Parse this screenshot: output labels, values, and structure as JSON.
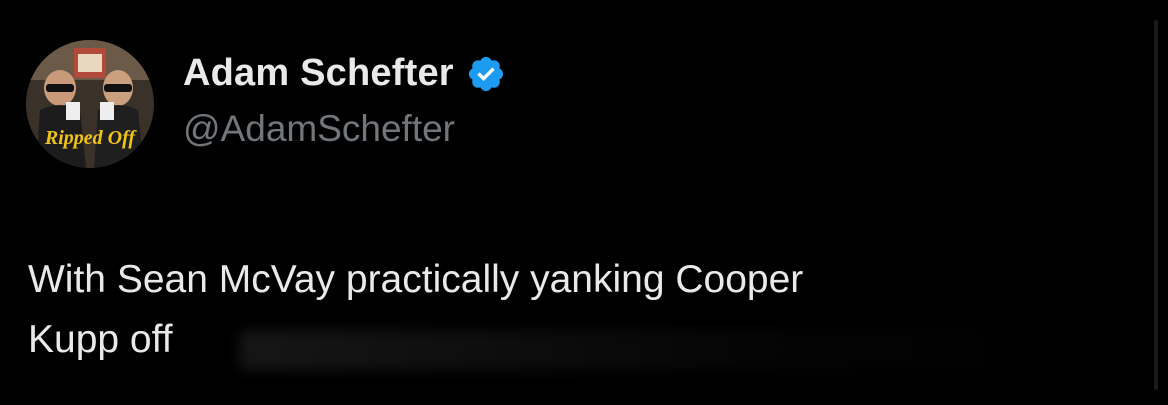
{
  "author": {
    "name": "Adam Schefter",
    "handle": "@AdamSchefter",
    "verified": true,
    "avatar_caption": "Ripped Off"
  },
  "tweet": {
    "text_lines": [
      "With Sean McVay practically yanking Cooper",
      "Kupp off"
    ]
  },
  "colors": {
    "background": "#000000",
    "text": "#e7e9ea",
    "handle": "#71767b",
    "verified_badge": "#1d9bf0"
  },
  "icons": {
    "verified": "verified-badge-icon"
  }
}
